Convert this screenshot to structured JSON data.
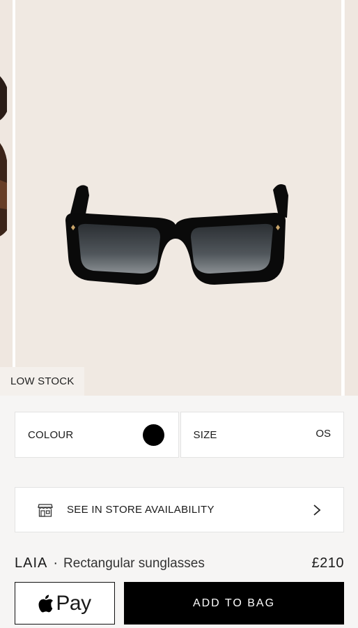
{
  "gallery": {
    "badge": "LOW STOCK"
  },
  "selectors": {
    "colour_label": "COLOUR",
    "colour_value": "#000000",
    "size_label": "SIZE",
    "size_value": "OS"
  },
  "store": {
    "label": "SEE IN STORE AVAILABILITY",
    "icon": "store-icon"
  },
  "product": {
    "brand": "LAIA",
    "separator": "·",
    "name": "Rectangular sunglasses",
    "price": "£210"
  },
  "actions": {
    "applepay_label": "Pay",
    "add_to_bag_label": "ADD TO BAG"
  },
  "colors": {
    "accent": "#000000",
    "background": "#f0e9e2"
  }
}
